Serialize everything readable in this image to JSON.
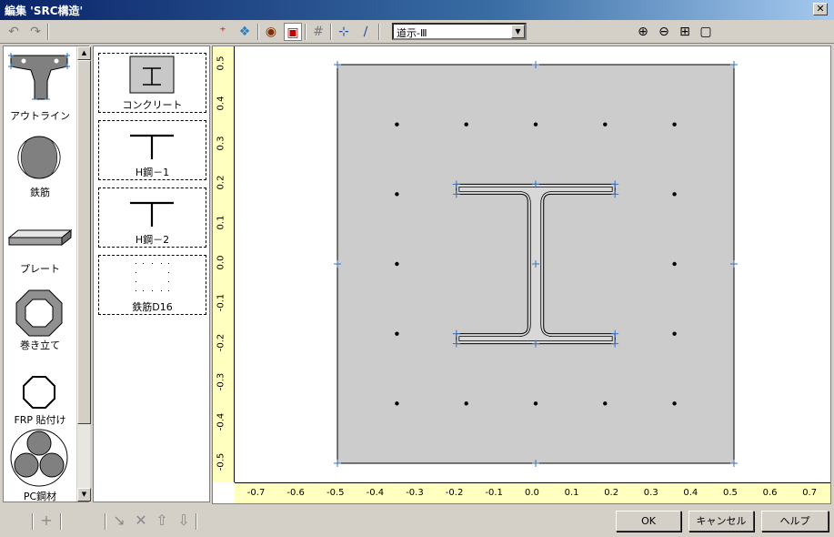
{
  "window": {
    "title": "編集 'SRC構造'",
    "close_glyph": "✕"
  },
  "toolbar": {
    "undo_icon": "↶",
    "redo_icon": "↷",
    "add_point_icon": "⁺",
    "vertex_icon": "❖",
    "palette_icon": "◉",
    "color_icon": "▣",
    "grid_icon": "#",
    "axis_icon": "⊹",
    "slant_icon": "∕",
    "design_code": "道示-Ⅲ",
    "dropdown_arrow": "▼",
    "zoom_in_icon": "⊕",
    "zoom_out_icon": "⊖",
    "fit_icon": "⊞",
    "frame_icon": "▢"
  },
  "palette": {
    "items": [
      {
        "label": "アウトライン",
        "icon": "outline-icon"
      },
      {
        "label": "鉄筋",
        "icon": "rebar-icon"
      },
      {
        "label": "プレート",
        "icon": "plate-icon"
      },
      {
        "label": "巻き立て",
        "icon": "jacketing-icon"
      },
      {
        "label": "FRP 貼付け",
        "icon": "frp-icon"
      },
      {
        "label": "PC鋼材",
        "icon": "pc-strand-icon"
      }
    ],
    "scroll_up": "▲",
    "scroll_down": "▼"
  },
  "elements": {
    "items": [
      {
        "label": "コンクリート"
      },
      {
        "label": "H鋼－1"
      },
      {
        "label": "H鋼－2"
      },
      {
        "label": "鉄筋D16"
      }
    ]
  },
  "canvas": {
    "y_ticks": [
      "-0.5",
      "-0.4",
      "-0.3",
      "-0.2",
      "-0.1",
      "0.0",
      "0.1",
      "0.2",
      "0.3",
      "0.4",
      "0.5"
    ],
    "x_ticks": [
      "-0.7",
      "-0.6",
      "-0.5",
      "-0.4",
      "-0.3",
      "-0.2",
      "-0.1",
      "0.0",
      "0.1",
      "0.2",
      "0.3",
      "0.4",
      "0.5",
      "0.6",
      "0.7"
    ],
    "concrete_color": "#cccccc",
    "rebars": [
      [
        -0.35,
        0.35
      ],
      [
        -0.175,
        0.35
      ],
      [
        0.0,
        0.35
      ],
      [
        0.175,
        0.35
      ],
      [
        0.35,
        0.35
      ],
      [
        -0.35,
        0.175
      ],
      [
        0.35,
        0.175
      ],
      [
        -0.35,
        0.0
      ],
      [
        0.35,
        0.0
      ],
      [
        -0.35,
        -0.175
      ],
      [
        0.35,
        -0.175
      ],
      [
        -0.35,
        -0.35
      ],
      [
        -0.175,
        -0.35
      ],
      [
        0.0,
        -0.35
      ],
      [
        0.175,
        -0.35
      ],
      [
        0.35,
        -0.35
      ]
    ]
  },
  "footer": {
    "add_icon": "+",
    "draw_icon": "↘",
    "delete_icon": "✕",
    "up_icon": "⇧",
    "down_icon": "⇩",
    "ok": "OK",
    "cancel": "キャンセル",
    "help": "ヘルプ"
  }
}
